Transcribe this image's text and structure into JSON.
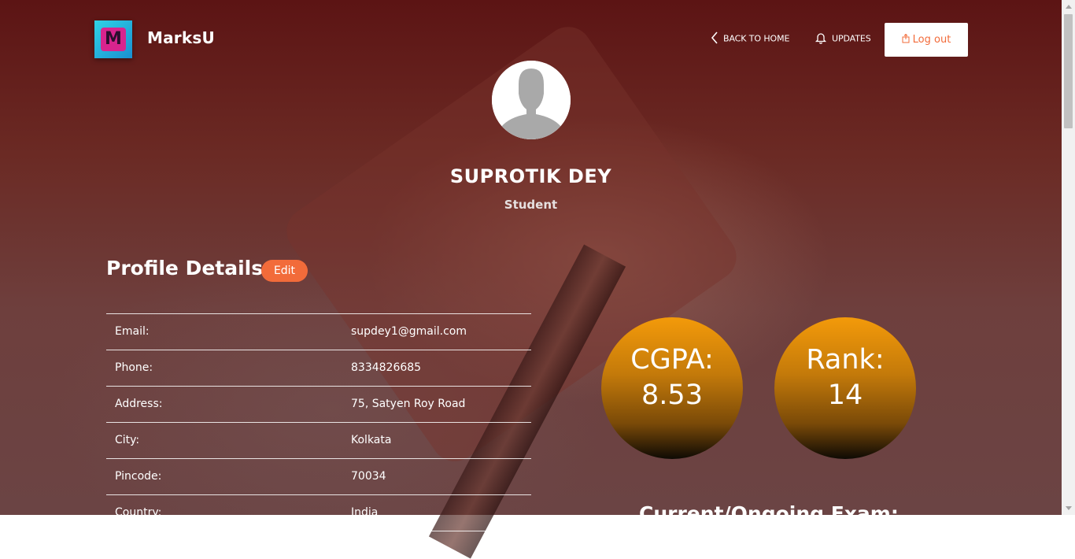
{
  "brand": {
    "name": "MarksU",
    "logo_letter": "M"
  },
  "nav": {
    "back_label": "BACK TO HOME",
    "updates_label": "UPDATES",
    "logout_label": "Log out"
  },
  "profile": {
    "name": "SUPROTIK DEY",
    "role": "Student"
  },
  "details": {
    "title": "Profile Details",
    "edit_label": "Edit",
    "rows": [
      {
        "key": "Email:",
        "value": "supdey1@gmail.com"
      },
      {
        "key": "Phone:",
        "value": "8334826685"
      },
      {
        "key": "Address:",
        "value": "75, Satyen Roy Road"
      },
      {
        "key": "City:",
        "value": "Kolkata"
      },
      {
        "key": "Pincode:",
        "value": "70034"
      },
      {
        "key": "Country:",
        "value": "India"
      }
    ]
  },
  "stats": {
    "cgpa_label": "CGPA:",
    "cgpa_value": "8.53",
    "rank_label": "Rank:",
    "rank_value": "14"
  },
  "exam": {
    "title": "Current/Ongoing Exam:"
  },
  "colors": {
    "accent": "#f26b3a",
    "circle_top": "#f39a0a"
  }
}
